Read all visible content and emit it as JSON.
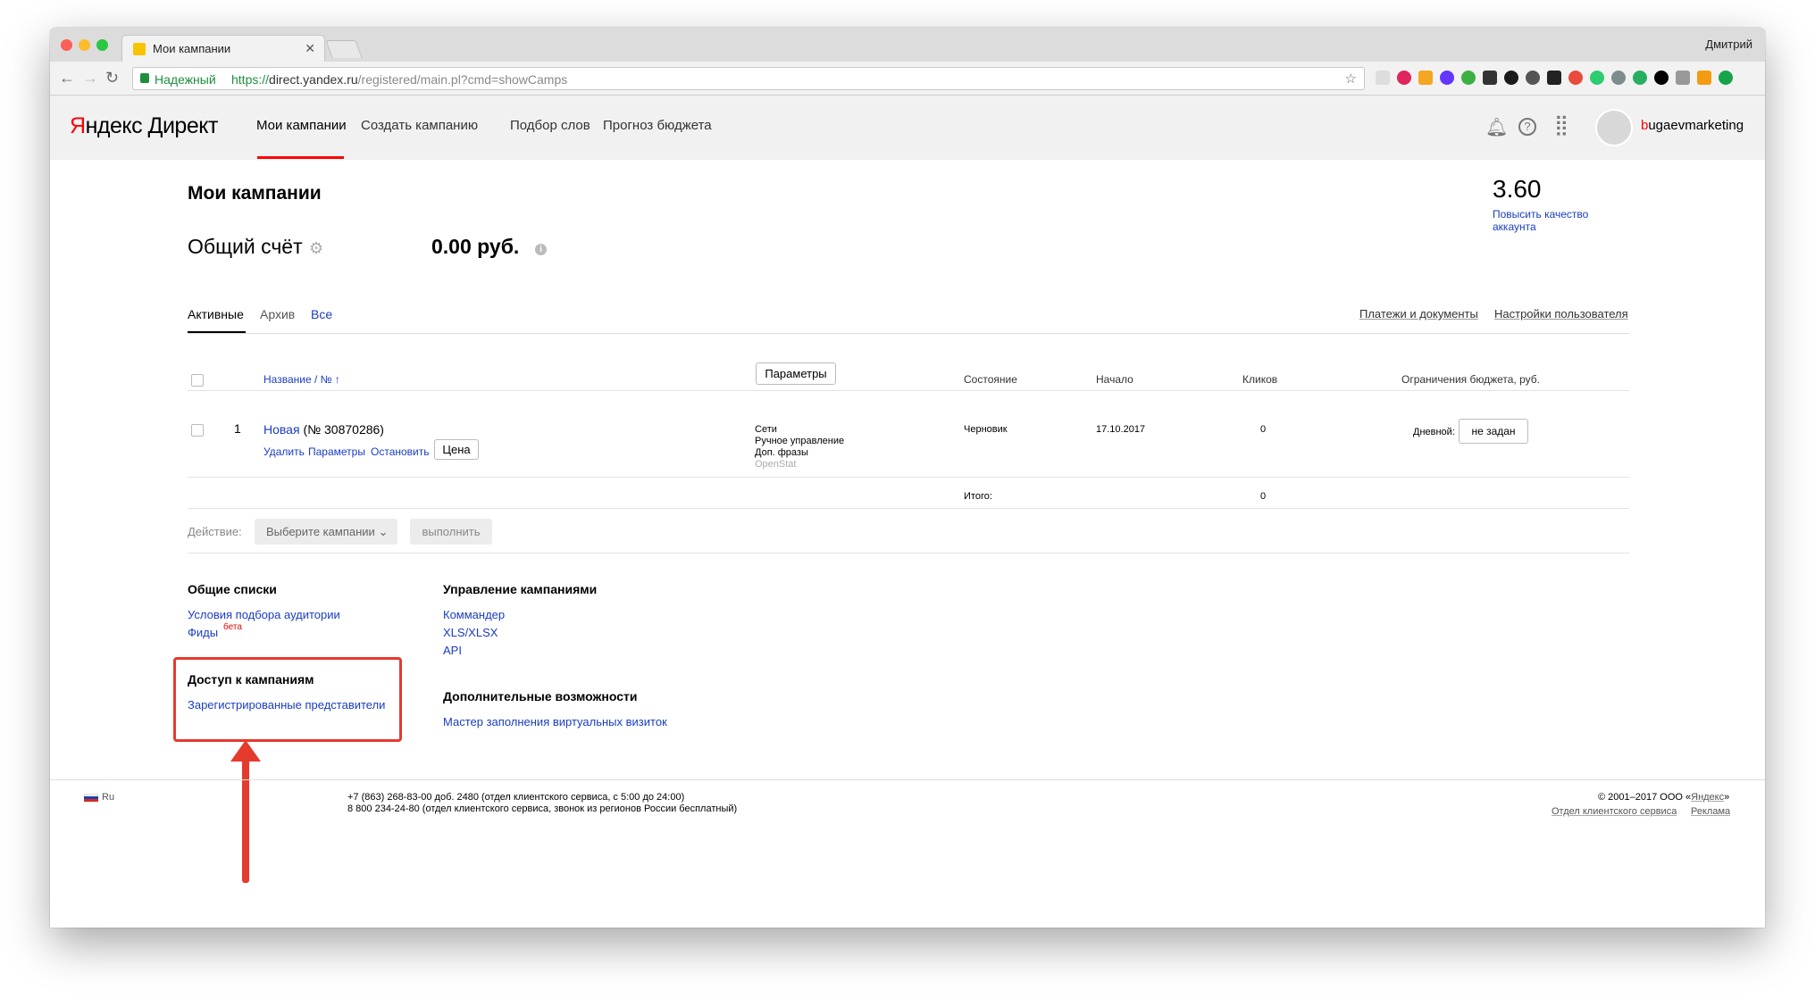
{
  "browser": {
    "tab_title": "Мои кампании",
    "profile_name": "Дмитрий",
    "secure_label": "Надежный",
    "url_scheme": "https://",
    "url_host": "direct.yandex.ru",
    "url_path": "/registered/main.pl?cmd=showCamps"
  },
  "header": {
    "logo_first": "Я",
    "logo_rest": "ндекс Директ",
    "nav": [
      "Мои кампании",
      "Создать кампанию",
      "Подбор слов",
      "Прогноз бюджета"
    ],
    "username_first": "b",
    "username_rest": "ugaevmarketing"
  },
  "main": {
    "title": "Мои кампании",
    "rating": "3.60",
    "rating_link": "Повысить качество аккаунта",
    "account_label": "Общий счёт",
    "account_sum": "0.00 руб.",
    "tabs": [
      "Активные",
      "Архив",
      "Все"
    ],
    "right_links": [
      "Платежи и документы",
      "Настройки пользователя"
    ]
  },
  "table": {
    "columns": {
      "name": "Название / № ↑",
      "params_button": "Параметры",
      "state": "Состояние",
      "start": "Начало",
      "clicks": "Кликов",
      "budget": "Ограничения бюджета, руб."
    },
    "rows": [
      {
        "index": "1",
        "name": "Новая",
        "number": "(№ 30870286)",
        "actions": [
          "Удалить",
          "Параметры",
          "Остановить"
        ],
        "price_button": "Цена",
        "params": [
          "Сети",
          "Ручное управление",
          "Доп. фразы",
          "OpenStat"
        ],
        "state": "Черновик",
        "start": "17.10.2017",
        "clicks": "0",
        "budget_label": "Дневной:",
        "budget_value": "не задан"
      }
    ],
    "total_label": "Итого:",
    "total_clicks": "0"
  },
  "actions_bar": {
    "label": "Действие:",
    "select": "Выберите кампании",
    "run": "выполнить"
  },
  "sections": {
    "common_lists": {
      "title": "Общие списки",
      "links": [
        "Условия подбора аудитории",
        "Фиды"
      ],
      "beta": "бета"
    },
    "access": {
      "title": "Доступ к кампаниям",
      "links": [
        "Зарегистрированные представители"
      ]
    },
    "management": {
      "title": "Управление кампаниями",
      "links": [
        "Коммандер",
        "XLS/XLSX",
        "API"
      ]
    },
    "extra": {
      "title": "Дополнительные возможности",
      "links": [
        "Мастер заполнения виртуальных визиток"
      ]
    }
  },
  "footer": {
    "lang": "Ru",
    "phone1": "+7 (863) 268-83-00 доб. 2480 (отдел клиентского сервиса, с 5:00 до 24:00)",
    "phone2": "8 800 234-24-80 (отдел клиентского сервиса, звонок из регионов России бесплатный)",
    "copyright": "© 2001–2017 ООО «",
    "copyright_link": "Яндекс",
    "copyright_end": "»",
    "links": [
      "Отдел клиентского сервиса",
      "Реклама"
    ]
  },
  "colors": {
    "accent_red": "#ff0000",
    "link_blue": "#1a3dc1",
    "annotation_red": "#e53a2e"
  }
}
